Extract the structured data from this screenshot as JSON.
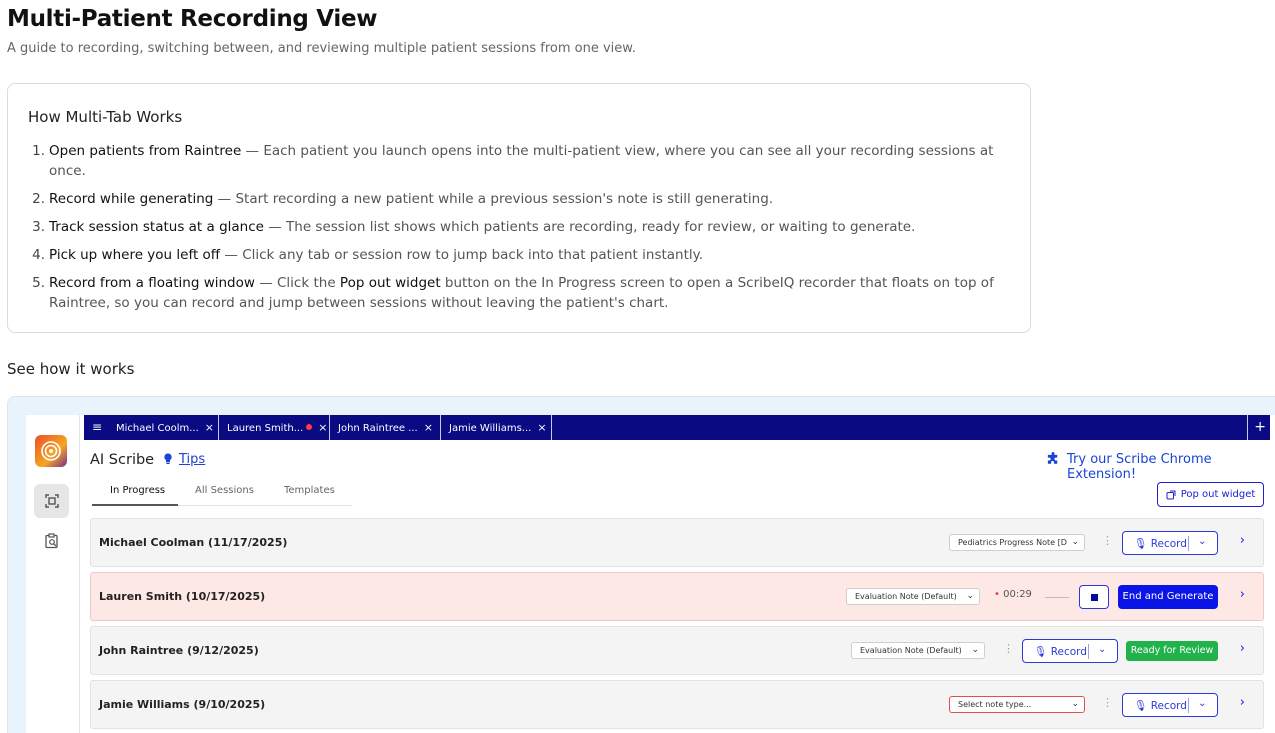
{
  "page": {
    "title": "Multi-Patient Recording View",
    "subtitle": "A guide to recording, switching between, and reviewing multiple patient sessions from one view."
  },
  "how": {
    "title": "How Multi-Tab Works",
    "steps": [
      {
        "num": "1.",
        "lead": "Open patients from Raintree",
        "text": " — Each patient you launch opens into the multi-patient view, where you can see all your recording sessions at once."
      },
      {
        "num": "2.",
        "lead": "Record while generating",
        "text": " — Start recording a new patient while a previous session's note is still generating."
      },
      {
        "num": "3.",
        "lead": "Track session status at a glance",
        "text": " — The session list shows which patients are recording, ready for review, or waiting to generate."
      },
      {
        "num": "4.",
        "lead": "Pick up where you left off",
        "text": " — Click any tab or session row to jump back into that patient instantly."
      },
      {
        "num": "5.",
        "lead": "Record from a floating window",
        "text_before": " — Click the ",
        "em": "Pop out widget",
        "text_after": " button on the In Progress screen to open a ScribeIQ recorder that floats on top of Raintree, so you can record and jump between sessions without leaving the patient's chart."
      }
    ]
  },
  "see_how": "See how it works",
  "demo": {
    "tabs": [
      {
        "label": "Michael Coolm...",
        "close": "×"
      },
      {
        "label": "Lauren Smith...",
        "close": "×",
        "recording": true
      },
      {
        "label": "John Raintree ...",
        "close": "×"
      },
      {
        "label": "Jamie Williams...",
        "close": "×"
      }
    ],
    "menu_glyph": "≡",
    "add_tab": "+",
    "app_title": "AI Scribe",
    "tips": "Tips",
    "extension_link": "Try our Scribe Chrome Extension!",
    "subtabs": [
      "In Progress",
      "All Sessions",
      "Templates"
    ],
    "popout_label": "Pop out widget",
    "rows": [
      {
        "name": "Michael Coolman (11/17/2025)",
        "note": "Pediatrics Progress Note [D",
        "record": "Record"
      },
      {
        "name": "Lauren Smith (10/17/2025)",
        "note": "Evaluation Note (Default)",
        "timer": "00:29",
        "end": "End and Generate"
      },
      {
        "name": "John Raintree (9/12/2025)",
        "note": "Evaluation Note (Default)",
        "record": "Record",
        "status": "Ready for Review"
      },
      {
        "name": "Jamie Williams (9/10/2025)",
        "note": "Select note type...",
        "record": "Record"
      }
    ],
    "colors": {
      "tabbar": "#0a0a82",
      "primary": "#0a14e6",
      "ready": "#22b24c",
      "recording_row": "#fde8e6"
    }
  }
}
